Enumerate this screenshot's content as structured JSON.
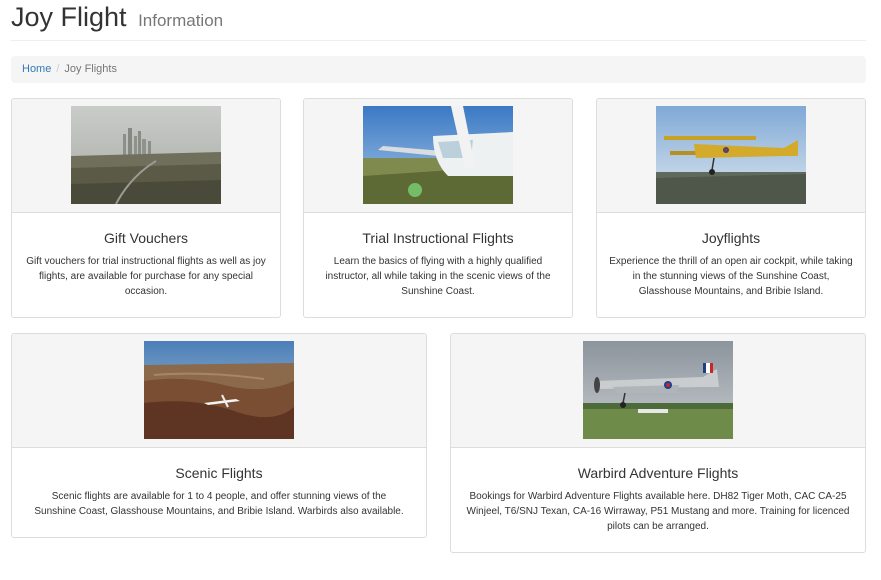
{
  "header": {
    "title": "Joy Flight",
    "subtitle": "Information"
  },
  "breadcrumb": {
    "home": "Home",
    "separator": "/",
    "current": "Joy Flights"
  },
  "cards": [
    {
      "title": "Gift Vouchers",
      "text": "Gift vouchers for trial instructional flights as well as joy flights, are available for purchase for any special occasion.",
      "image": "city-skyline-photo"
    },
    {
      "title": "Trial Instructional Flights",
      "text": "Learn the basics of flying with a highly qualified instructor, all while taking in the scenic views of the Sunshine Coast.",
      "image": "cessna-wing-photo"
    },
    {
      "title": "Joyflights",
      "text": "Experience the thrill of an open air cockpit, while taking in the stunning views of the Sunshine Coast, Glasshouse Mountains, and Bribie Island.",
      "image": "tiger-moth-biplane-photo"
    },
    {
      "title": "Scenic Flights",
      "text": "Scenic flights are available for 1 to 4 people, and offer stunning views of the Sunshine Coast, Glasshouse Mountains, and Bribie Island. Warbirds also available.",
      "image": "scenic-landscape-plane-photo"
    },
    {
      "title": "Warbird Adventure Flights",
      "text": "Bookings for Warbird Adventure Flights available here. DH82 Tiger Moth, CAC CA-25 Winjeel, T6/SNJ Texan, CA-16 Wirraway, P51 Mustang and more. Training for licenced pilots can be arranged.",
      "image": "warbird-plane-photo"
    }
  ],
  "colors": {
    "link": "#337ab7",
    "panel_bg": "#f5f5f5",
    "border": "#dddddd",
    "muted": "#777777"
  }
}
